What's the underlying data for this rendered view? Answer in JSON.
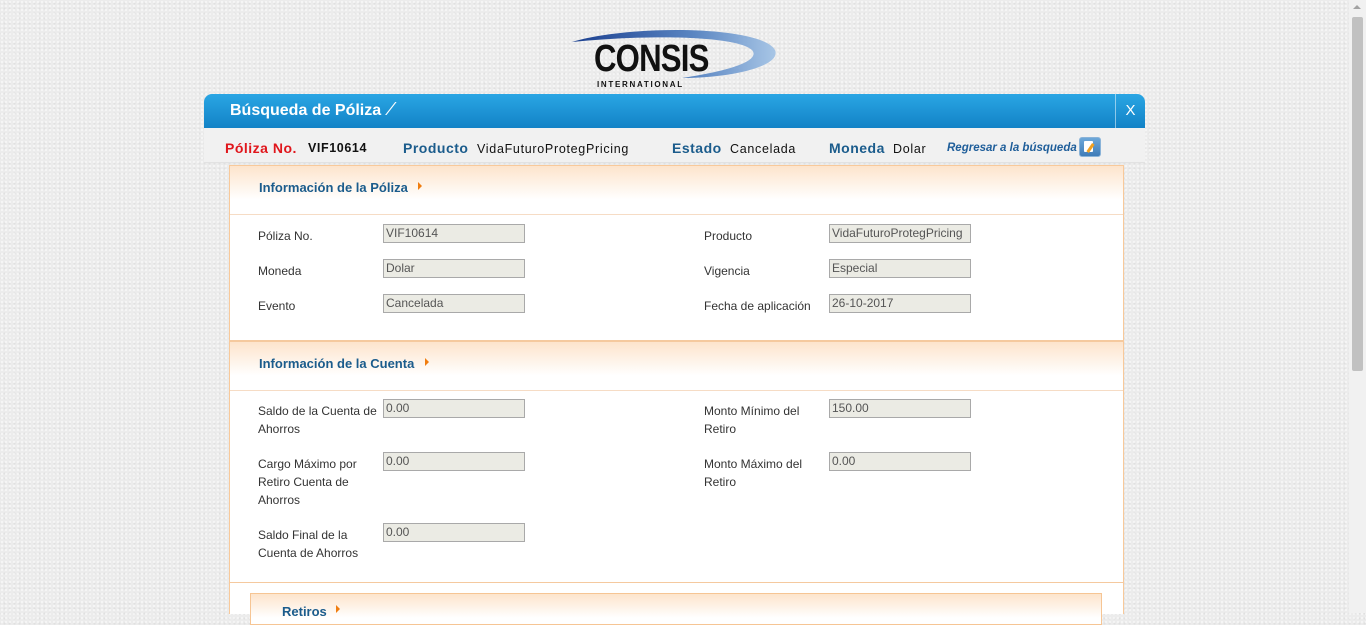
{
  "logo": {
    "word": "CONSIS",
    "sub": "INTERNATIONAL"
  },
  "window": {
    "title": "Búsqueda de Póliza",
    "close_label": "X"
  },
  "policy_bar": {
    "poliza_label": "Póliza No.",
    "poliza_value": "VIF10614",
    "producto_label": "Producto",
    "producto_value": "VidaFuturoProtegPricing",
    "estado_label": "Estado",
    "estado_value": "Cancelada",
    "moneda_label": "Moneda",
    "moneda_value": "Dolar",
    "back_link": "Regresar a la búsqueda"
  },
  "policy_info": {
    "title": "Información de la Póliza",
    "poliza_label": "Póliza No.",
    "poliza_value": "VIF10614",
    "producto_label": "Producto",
    "producto_value": "VidaFuturoProtegPricing",
    "moneda_label": "Moneda",
    "moneda_value": "Dolar",
    "vigencia_label": "Vigencia",
    "vigencia_value": "Especial",
    "evento_label": "Evento",
    "evento_value": "Cancelada",
    "fecha_label": "Fecha de aplicación",
    "fecha_value": "26-10-2017"
  },
  "account_info": {
    "title": "Información de la Cuenta",
    "saldo_label_1": "Saldo de la Cuenta de",
    "saldo_label_2": "Ahorros",
    "saldo_value": "0.00",
    "monto_min_label_1": "Monto Mínimo del",
    "monto_min_label_2": "Retiro",
    "monto_min_value": "150.00",
    "cargo_label_1": "Cargo Máximo por",
    "cargo_label_2": "Retiro Cuenta de",
    "cargo_label_3": "Ahorros",
    "cargo_value": "0.00",
    "monto_max_label_1": "Monto Máximo del",
    "monto_max_label_2": "Retiro",
    "monto_max_value": "0.00",
    "saldo_final_label_1": "Saldo Final de la",
    "saldo_final_label_2": "Cuenta de Ahorros",
    "saldo_final_value": "0.00"
  },
  "retiros": {
    "title": "Retiros"
  },
  "colors": {
    "title_bar": "#1e95d8",
    "label_red": "#e0161c",
    "label_blue": "#1b5c8c",
    "section_border": "#f8c99a",
    "arrow": "#f07d0f"
  }
}
